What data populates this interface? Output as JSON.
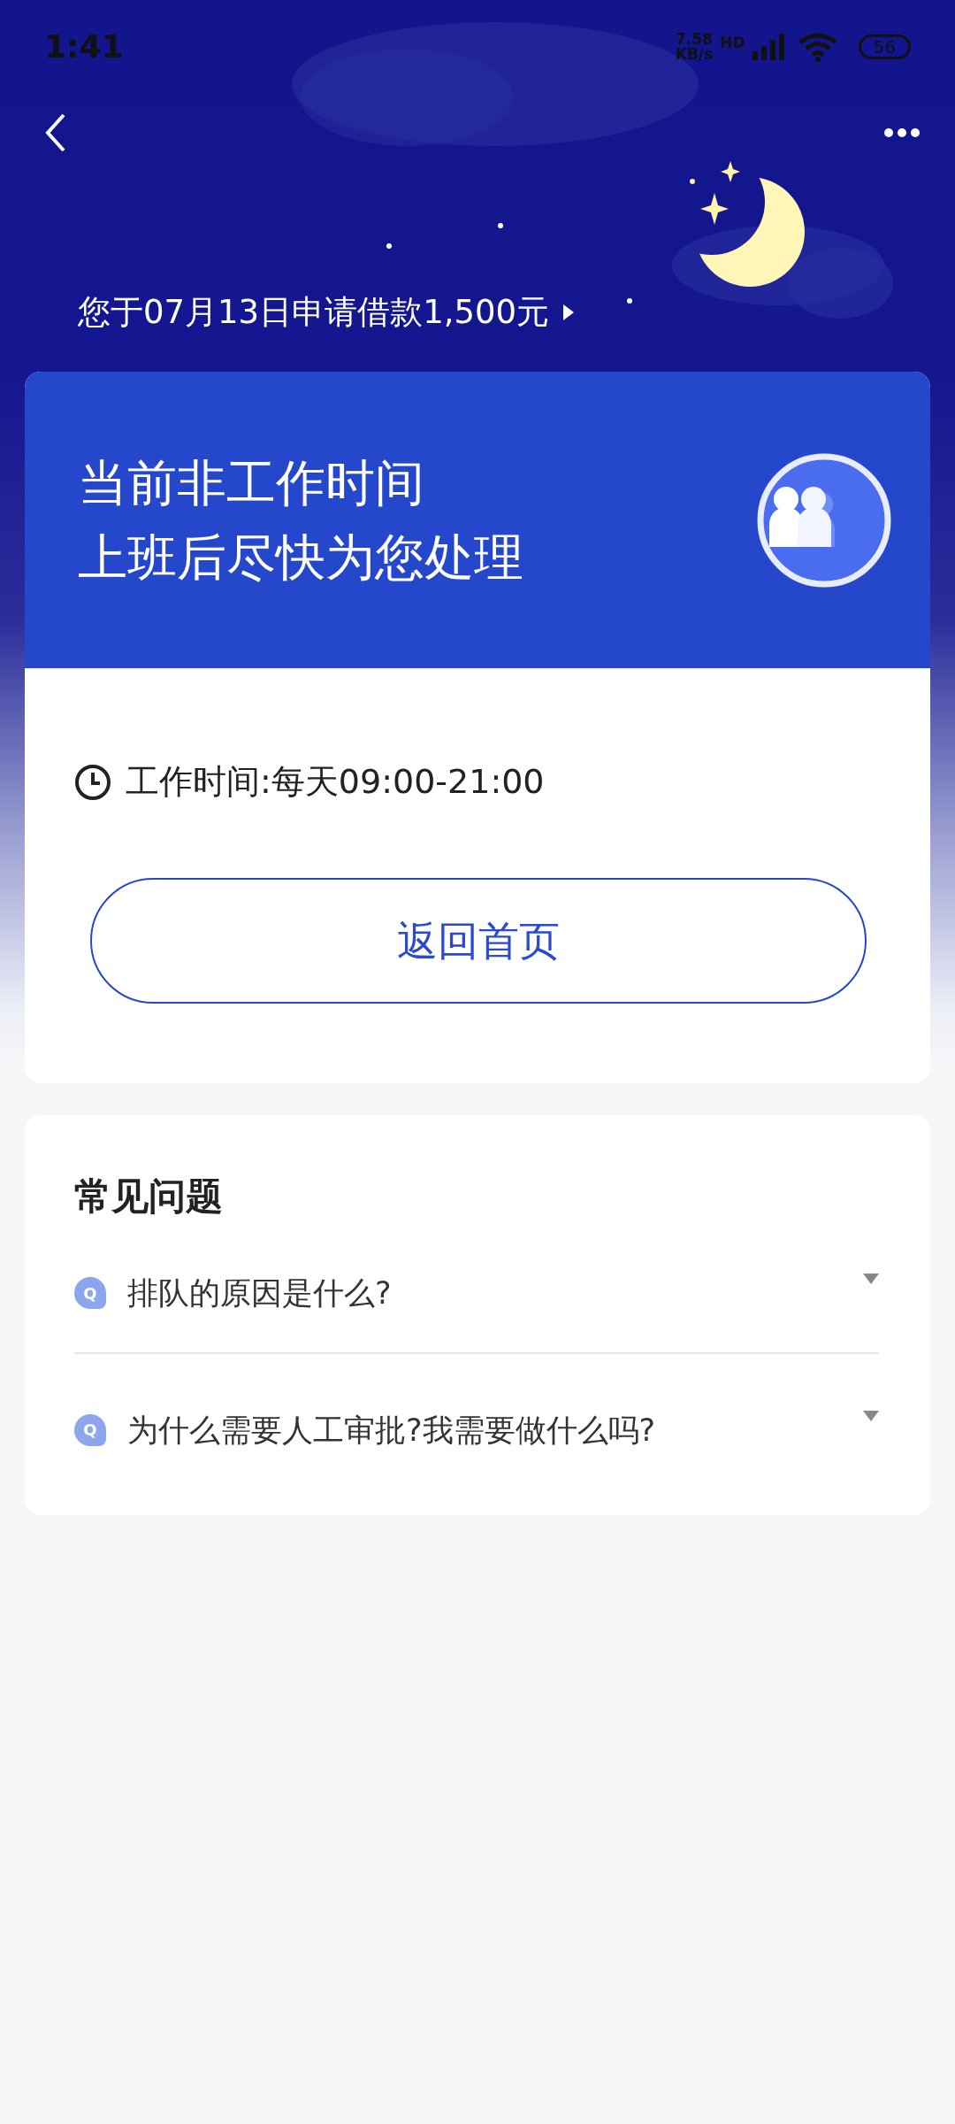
{
  "status_bar": {
    "time": "1:41",
    "speed_value": "7.58",
    "speed_unit": "KB/s",
    "network": "HD",
    "battery": "56"
  },
  "application": {
    "text": "您于07月13日申请借款1,500元"
  },
  "notice_card": {
    "title_lines": [
      "当前非工作时间",
      "上班后尽快为您处理"
    ],
    "hours": "工作时间:每天09:00-21:00",
    "button": "返回首页"
  },
  "faq": {
    "title": "常见问题",
    "items": [
      {
        "icon_letter": "Q",
        "question": "排队的原因是什么?",
        "expanded": false
      },
      {
        "icon_letter": "Q",
        "question": "为什么需要人工审批?我需要做什么吗?",
        "expanded": false
      }
    ]
  }
}
